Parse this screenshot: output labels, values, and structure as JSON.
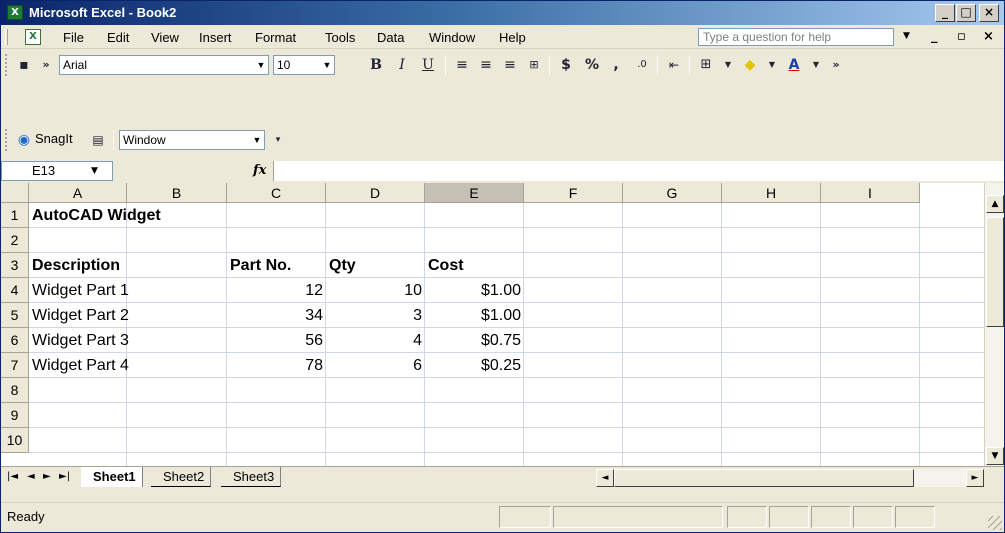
{
  "window": {
    "title": "Microsoft Excel - Book2"
  },
  "menu": {
    "items": [
      "File",
      "Edit",
      "View",
      "Insert",
      "Format",
      "Tools",
      "Data",
      "Window",
      "Help"
    ],
    "help_placeholder": "Type a question for help"
  },
  "formatting": {
    "font_name": "Arial",
    "font_size": "10"
  },
  "snagit": {
    "label": "SnagIt",
    "capture_mode": "Window"
  },
  "formula_bar": {
    "name_box": "E13",
    "fx_label": "fx",
    "value": ""
  },
  "columns": [
    "A",
    "B",
    "C",
    "D",
    "E",
    "F",
    "G",
    "H",
    "I"
  ],
  "selected_column": "E",
  "rows": [
    {
      "num": "1",
      "cells": {
        "A": "AutoCAD Widget"
      }
    },
    {
      "num": "2",
      "cells": {}
    },
    {
      "num": "3",
      "cells": {
        "A": "Description",
        "C": "Part No.",
        "D": "Qty",
        "E": "Cost"
      }
    },
    {
      "num": "4",
      "cells": {
        "A": "Widget Part 1",
        "C": "12",
        "D": "10",
        "E": "$1.00"
      }
    },
    {
      "num": "5",
      "cells": {
        "A": "Widget Part 2",
        "C": "34",
        "D": "3",
        "E": "$1.00"
      }
    },
    {
      "num": "6",
      "cells": {
        "A": "Widget Part 3",
        "C": "56",
        "D": "4",
        "E": "$0.75"
      }
    },
    {
      "num": "7",
      "cells": {
        "A": "Widget Part 4",
        "C": "78",
        "D": "6",
        "E": "$0.25"
      }
    },
    {
      "num": "8",
      "cells": {}
    },
    {
      "num": "9",
      "cells": {}
    },
    {
      "num": "10",
      "cells": {}
    }
  ],
  "sheets": [
    "Sheet1",
    "Sheet2",
    "Sheet3"
  ],
  "active_sheet": "Sheet1",
  "status": {
    "text": "Ready"
  }
}
